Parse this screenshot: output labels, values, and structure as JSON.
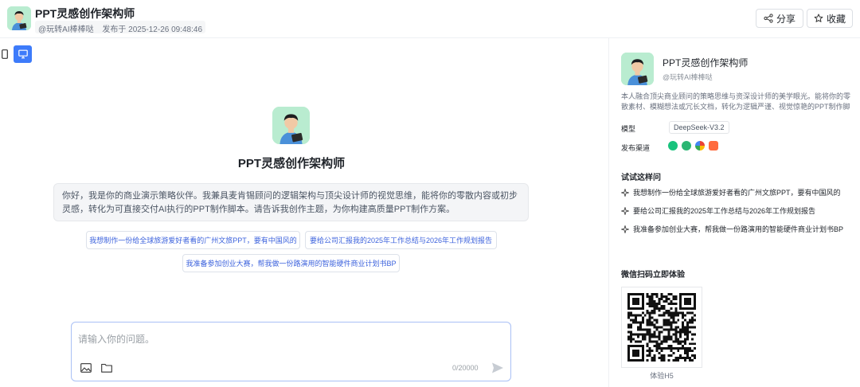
{
  "header": {
    "title": "PPT灵感创作架构师",
    "author": "@玩转AI棒棒哒",
    "published": "发布于 2025-12-26 09:48:46",
    "share_label": "分享",
    "favorite_label": "收藏"
  },
  "main": {
    "title": "PPT灵感创作架构师",
    "greeting": "你好，我是你的商业演示策略伙伴。我兼具麦肯锡顾问的逻辑架构与顶尖设计师的视觉思维，能将你的零散内容或初步灵感，转化为可直接交付AI执行的PPT制作脚本。请告诉我创作主题，为你构建高质量PPT制作方案。",
    "suggestions": [
      "我想制作一份给全球旅游爱好者看的广州文旅PPT，要有中国风的",
      "要给公司汇报我的2025年工作总结与2026年工作规划报告",
      "我准备参加创业大赛，帮我做一份路演用的智能硬件商业计划书BP"
    ],
    "input_placeholder": "请输入你的问题。",
    "char_count": "0/20000"
  },
  "panel": {
    "name": "PPT灵感创作架构师",
    "author": "@玩转AI棒棒哒",
    "description": "本人融合顶尖商业顾问的策略思维与资深设计师的美学眼光。能将你的零散素材、模糊想法或冗长文档，转化为逻辑严谨、视觉惊艳的PPT制作脚本 ...",
    "model_label": "模型",
    "model_value": "DeepSeek-V3.2",
    "channel_label": "发布渠道",
    "try_title": "试试这样问",
    "try_items": [
      "我想制作一份给全球旅游爱好者看的广州文旅PPT，要有中国风的",
      "要给公司汇报我的2025年工作总结与2026年工作规划报告",
      "我准备参加创业大赛，帮我做一份路演用的智能硬件商业计划书BP"
    ],
    "qr_title": "微信扫码立即体验",
    "qr_caption": "体验H5"
  },
  "colors": {
    "accent": "#3d7bfa",
    "link": "#3d63dd",
    "avatar_bg": "#b9ecd0"
  }
}
